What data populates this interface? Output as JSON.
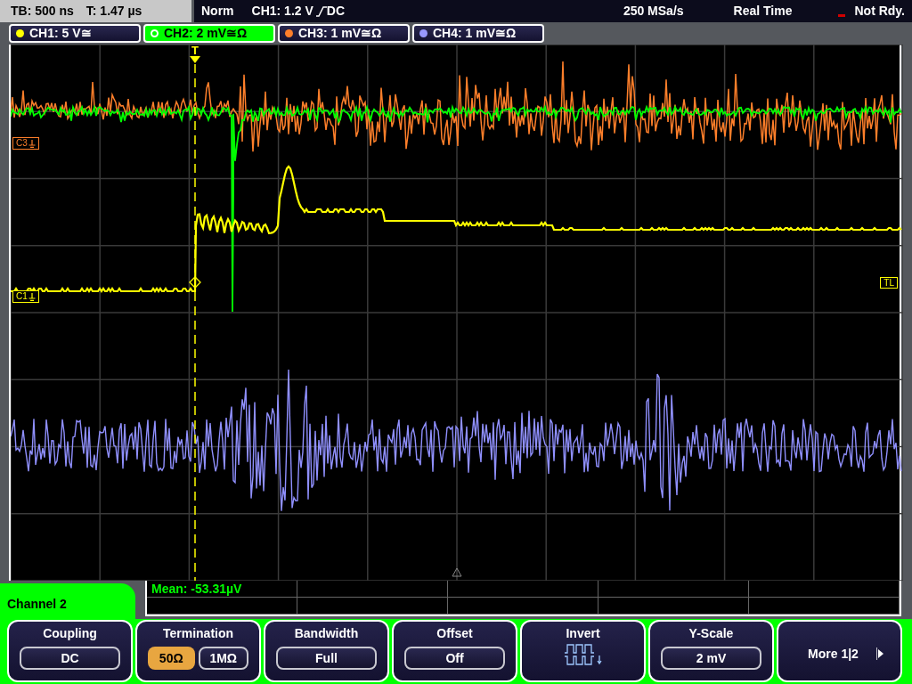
{
  "status_bar": {
    "timebase": "TB: 500 ns",
    "trigger_time": "T: 1.47 µs",
    "mode": "Norm",
    "trigger_source": "CH1: 1.2 V",
    "trigger_coupling": "DC",
    "sample_rate": "250 MSa/s",
    "acquisition": "Real Time",
    "state": "Not Rdy."
  },
  "channel_tabs": [
    {
      "label": "CH1: 5 V≅",
      "color": "#ffff00",
      "selected": false
    },
    {
      "label": "CH2: 2 mV≅Ω",
      "color": "#00ff00",
      "selected": true
    },
    {
      "label": "CH3: 1 mV≅Ω",
      "color": "#ff7f2a",
      "selected": false
    },
    {
      "label": "CH4: 1 mV≅Ω",
      "color": "#9999ff",
      "selected": false
    }
  ],
  "screen": {
    "trigger_marker": "T",
    "trigger_level_marker": "TL",
    "markers": [
      {
        "label": "C3",
        "color": "#ff7f2a"
      },
      {
        "label": "C1",
        "color": "#ffff00"
      }
    ]
  },
  "measurement": "Mean: -53.31µV",
  "menu": {
    "title": "Channel 2",
    "softkeys": [
      {
        "kind": "value",
        "title": "Coupling",
        "value": "DC"
      },
      {
        "kind": "options",
        "title": "Termination",
        "options": [
          {
            "label": "50Ω",
            "selected": true
          },
          {
            "label": "1MΩ",
            "selected": false
          }
        ]
      },
      {
        "kind": "value",
        "title": "Bandwidth",
        "value": "Full"
      },
      {
        "kind": "value",
        "title": "Offset",
        "value": "Off"
      },
      {
        "kind": "icon",
        "title": "Invert"
      },
      {
        "kind": "value",
        "title": "Y-Scale",
        "value": "2 mV"
      },
      {
        "kind": "more",
        "label": "More 1|2"
      }
    ]
  }
}
